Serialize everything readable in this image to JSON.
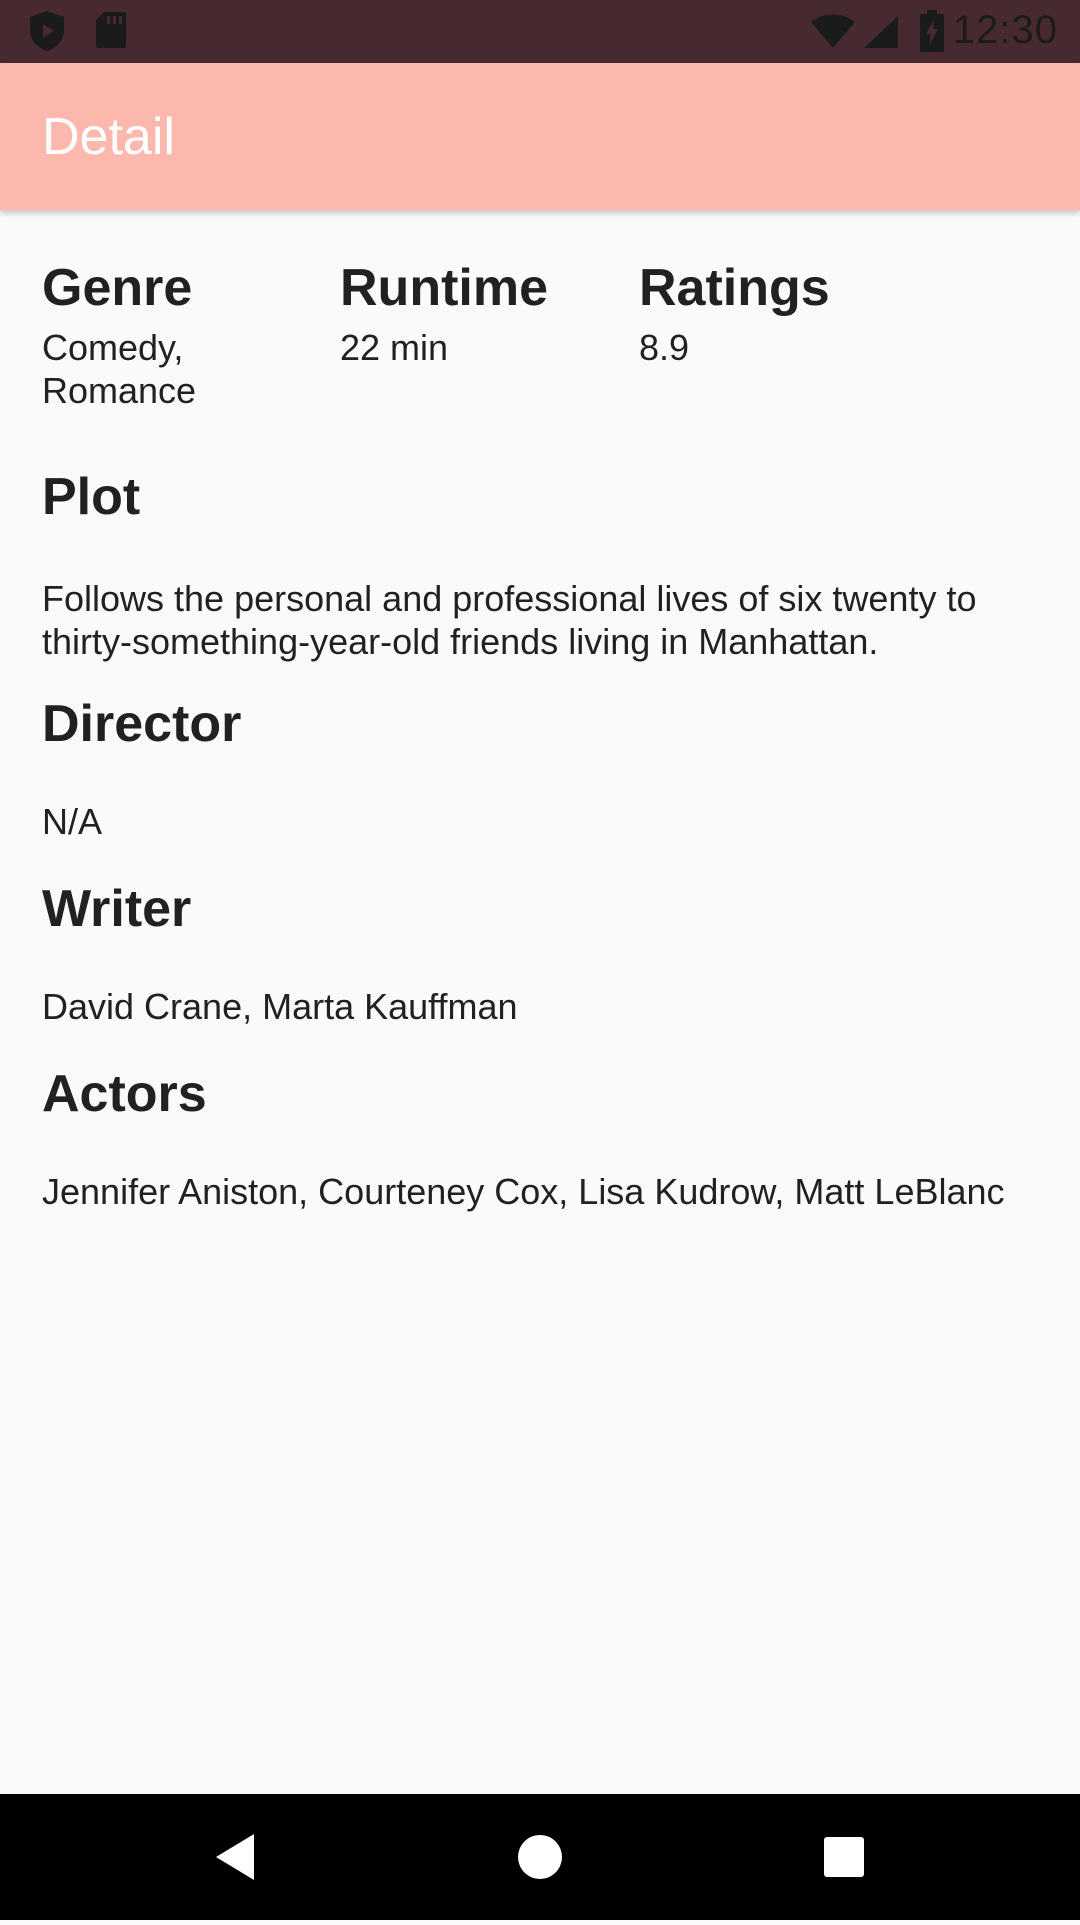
{
  "status_bar": {
    "time": "12:30",
    "icons": [
      "shield-icon",
      "sd-card-icon",
      "wifi-icon",
      "signal-icon",
      "battery-charging-icon"
    ]
  },
  "app_bar": {
    "title": "Detail",
    "color": "#fcb8ad"
  },
  "info": {
    "genre": {
      "label": "Genre",
      "value": "Comedy, Romance"
    },
    "runtime": {
      "label": "Runtime",
      "value": "22 min"
    },
    "ratings": {
      "label": "Ratings",
      "value": "8.9"
    }
  },
  "plot": {
    "label": "Plot",
    "value": "Follows the personal and professional lives of six twenty to thirty-something-year-old friends living in Manhattan."
  },
  "director": {
    "label": "Director",
    "value": "N/A"
  },
  "writer": {
    "label": "Writer",
    "value": "David Crane, Marta Kauffman"
  },
  "actors": {
    "label": "Actors",
    "value": "Jennifer Aniston, Courteney Cox, Lisa Kudrow, Matt LeBlanc"
  },
  "nav_bar": {
    "icons": [
      "back-icon",
      "home-icon",
      "recents-icon"
    ]
  }
}
